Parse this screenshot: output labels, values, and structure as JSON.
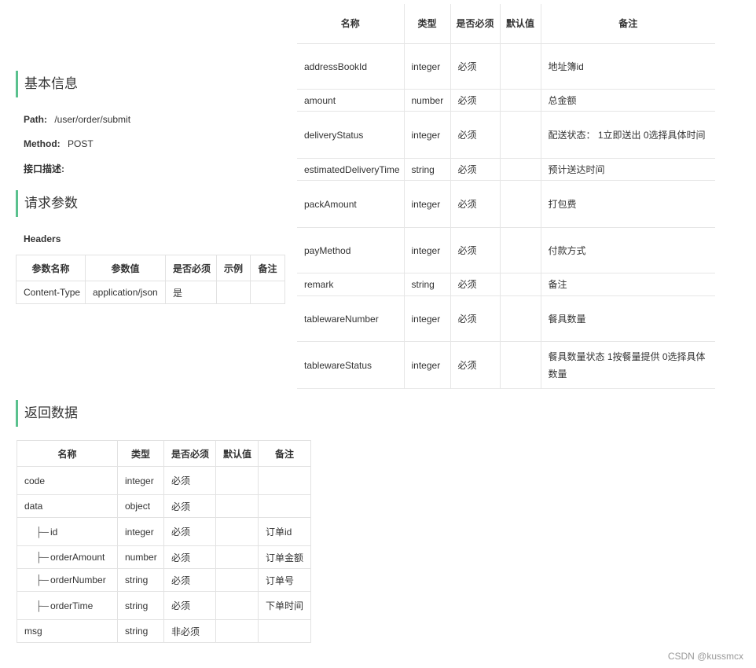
{
  "basic": {
    "title": "基本信息",
    "path_label": "Path:",
    "path_value": "/user/order/submit",
    "method_label": "Method:",
    "method_value": "POST",
    "desc_label": "接口描述:"
  },
  "request": {
    "title": "请求参数",
    "headers_label": "Headers",
    "headers_table": {
      "columns": [
        "参数名称",
        "参数值",
        "是否必须",
        "示例",
        "备注"
      ],
      "rows": [
        [
          "Content-Type",
          "application/json",
          "是",
          "",
          ""
        ]
      ]
    }
  },
  "body_table": {
    "columns": [
      "名称",
      "类型",
      "是否必须",
      "默认值",
      "备注"
    ],
    "rows": [
      [
        "addressBookId",
        "integer",
        "必须",
        "",
        "地址簿id"
      ],
      [
        "amount",
        "number",
        "必须",
        "",
        "总金额"
      ],
      [
        "deliveryStatus",
        "integer",
        "必须",
        "",
        "配送状态： 1立即送出  0选择具体时间"
      ],
      [
        "estimatedDeliveryTime",
        "string",
        "必须",
        "",
        "预计送达时间"
      ],
      [
        "packAmount",
        "integer",
        "必须",
        "",
        "打包费"
      ],
      [
        "payMethod",
        "integer",
        "必须",
        "",
        "付款方式"
      ],
      [
        "remark",
        "string",
        "必须",
        "",
        "备注"
      ],
      [
        "tablewareNumber",
        "integer",
        "必须",
        "",
        "餐具数量"
      ],
      [
        "tablewareStatus",
        "integer",
        "必须",
        "",
        "餐具数量状态  1按餐量提供  0选择具体数量"
      ]
    ]
  },
  "response": {
    "title": "返回数据",
    "columns": [
      "名称",
      "类型",
      "是否必须",
      "默认值",
      "备注"
    ],
    "child_prefix": "├─",
    "rows": [
      {
        "name": "code",
        "type": "integer",
        "required": "必须",
        "default": "",
        "note": "",
        "child": false
      },
      {
        "name": "data",
        "type": "object",
        "required": "必须",
        "default": "",
        "note": "",
        "child": false
      },
      {
        "name": "id",
        "type": "integer",
        "required": "必须",
        "default": "",
        "note": "订单id",
        "child": true
      },
      {
        "name": "orderAmount",
        "type": "number",
        "required": "必须",
        "default": "",
        "note": "订单金额",
        "child": true
      },
      {
        "name": "orderNumber",
        "type": "string",
        "required": "必须",
        "default": "",
        "note": "订单号",
        "child": true
      },
      {
        "name": "orderTime",
        "type": "string",
        "required": "必须",
        "default": "",
        "note": "下单时间",
        "child": true
      },
      {
        "name": "msg",
        "type": "string",
        "required": "非必须",
        "default": "",
        "note": "",
        "child": false
      }
    ]
  },
  "watermark": "CSDN @kussmcx"
}
